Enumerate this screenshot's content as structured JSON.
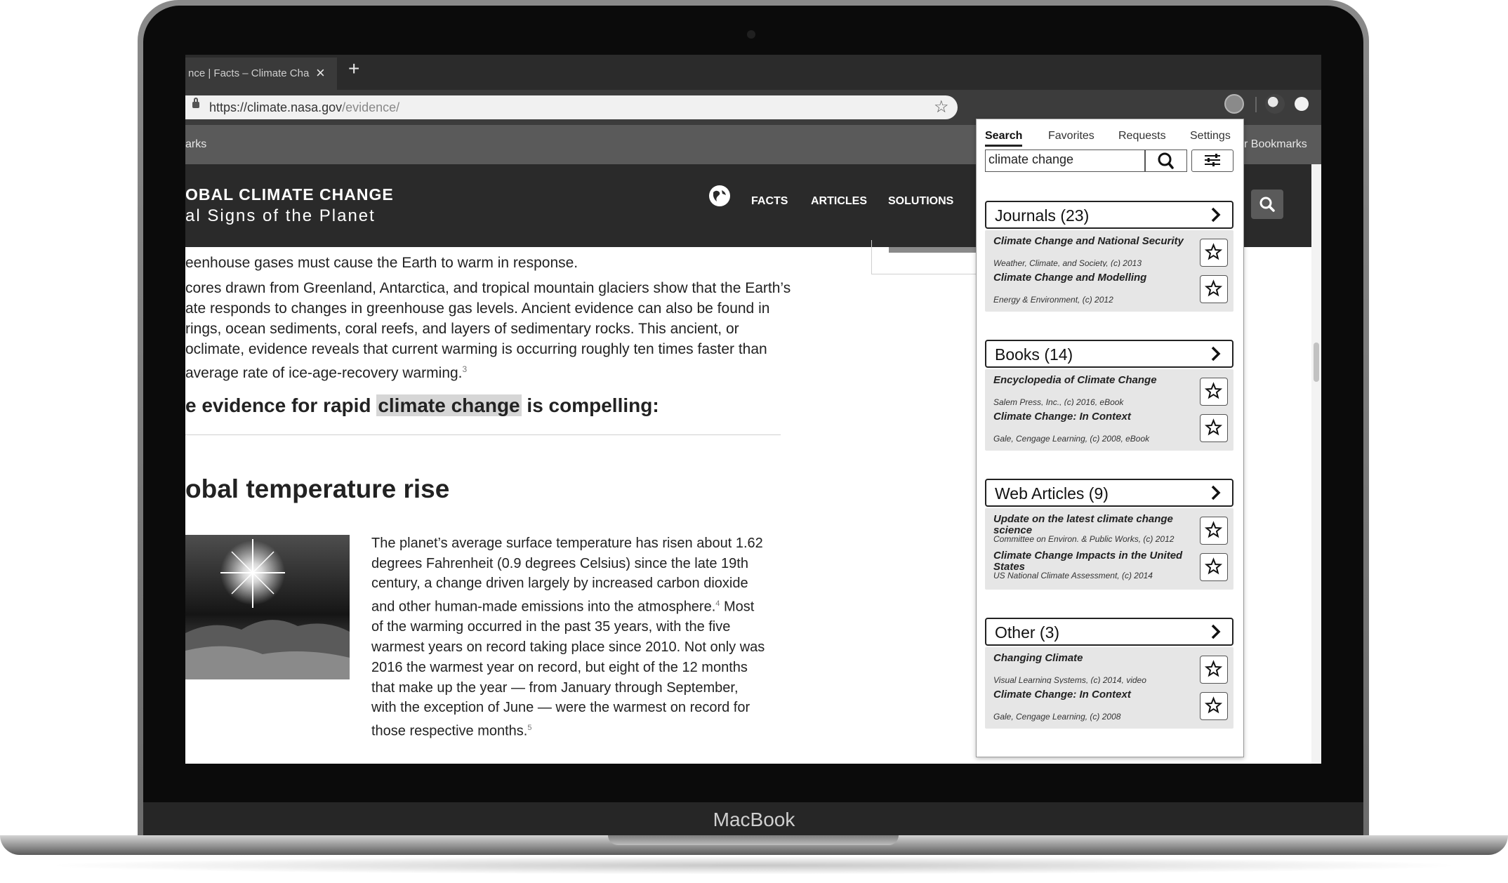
{
  "device": {
    "brand": "MacBook"
  },
  "browser": {
    "tab_title": "nce | Facts – Climate Cha",
    "tab_close": "×",
    "new_tab": "+",
    "url_host": "https://climate.nasa.gov",
    "url_path": "/evidence/",
    "bookmarks_left": "arks",
    "bookmarks_right": "r Bookmarks"
  },
  "site": {
    "title": "OBAL CLIMATE CHANGE",
    "subtitle": "al Signs of the Planet",
    "nav": [
      "FACTS",
      "ARTICLES",
      "SOLUTIONS"
    ]
  },
  "article": {
    "intro_line": "eenhouse gases must cause the Earth to warm in response.",
    "para1": [
      "cores drawn from Greenland, Antarctica, and tropical mountain glaciers show that the Earth’s",
      "ate responds to changes in greenhouse gas levels. Ancient evidence can also be found in",
      "rings, ocean sediments, coral reefs, and layers of sedimentary rocks. This ancient, or",
      "oclimate, evidence reveals that current warming is occurring roughly ten times faster than",
      "average rate of ice-age-recovery warming."
    ],
    "para1_footnote": "3",
    "evidence_before": "e evidence for rapid ",
    "evidence_highlight": "climate change",
    "evidence_after": " is compelling:",
    "section_heading": "obal temperature rise",
    "body_lines": [
      "The planet’s average surface temperature has risen about 1.62",
      "degrees Fahrenheit (0.9 degrees Celsius) since the late 19th",
      "century, a change driven largely by increased carbon dioxide",
      "and other human-made emissions into the atmosphere.",
      "of the warming occurred in the past 35 years, with the five",
      "warmest years on record taking place since 2010. Not only was",
      "2016 the warmest year on record, but eight of the 12 months",
      "that make up the year — from January through September,",
      "with the exception of June — were the warmest on record for",
      "those respective months."
    ],
    "footnote_4": "4",
    "line4_tail": " Most",
    "footnote_5": "5"
  },
  "popup": {
    "tabs": [
      "Search",
      "Favorites",
      "Requests",
      "Settings"
    ],
    "active_tab": "Search",
    "query": "climate change",
    "categories": [
      {
        "label": "Journals (23)",
        "items": [
          {
            "title": "Climate Change and National Security",
            "meta": "Weather, Climate, and Society, (c) 2013"
          },
          {
            "title": "Climate Change and Modelling",
            "meta": "Energy & Environment, (c) 2012"
          }
        ]
      },
      {
        "label": "Books (14)",
        "items": [
          {
            "title": "Encyclopedia of Climate Change",
            "meta": "Salem Press, Inc., (c) 2016, eBook"
          },
          {
            "title": "Climate Change: In Context",
            "meta": "Gale, Cengage Learning, (c) 2008, eBook"
          }
        ]
      },
      {
        "label": "Web Articles (9)",
        "items": [
          {
            "title": "Update on the latest climate change science",
            "meta": "Committee on Environ. & Public Works, (c) 2012"
          },
          {
            "title": "Climate Change Impacts in the United States",
            "meta": "US National Climate Assessment, (c) 2014"
          }
        ]
      },
      {
        "label": "Other (3)",
        "items": [
          {
            "title": "Changing Climate",
            "meta": "Visual Learning Systems, (c) 2014, video"
          },
          {
            "title": "Climate Change: In Context",
            "meta": "Gale, Cengage Learning, (c) 2008"
          }
        ]
      }
    ]
  }
}
